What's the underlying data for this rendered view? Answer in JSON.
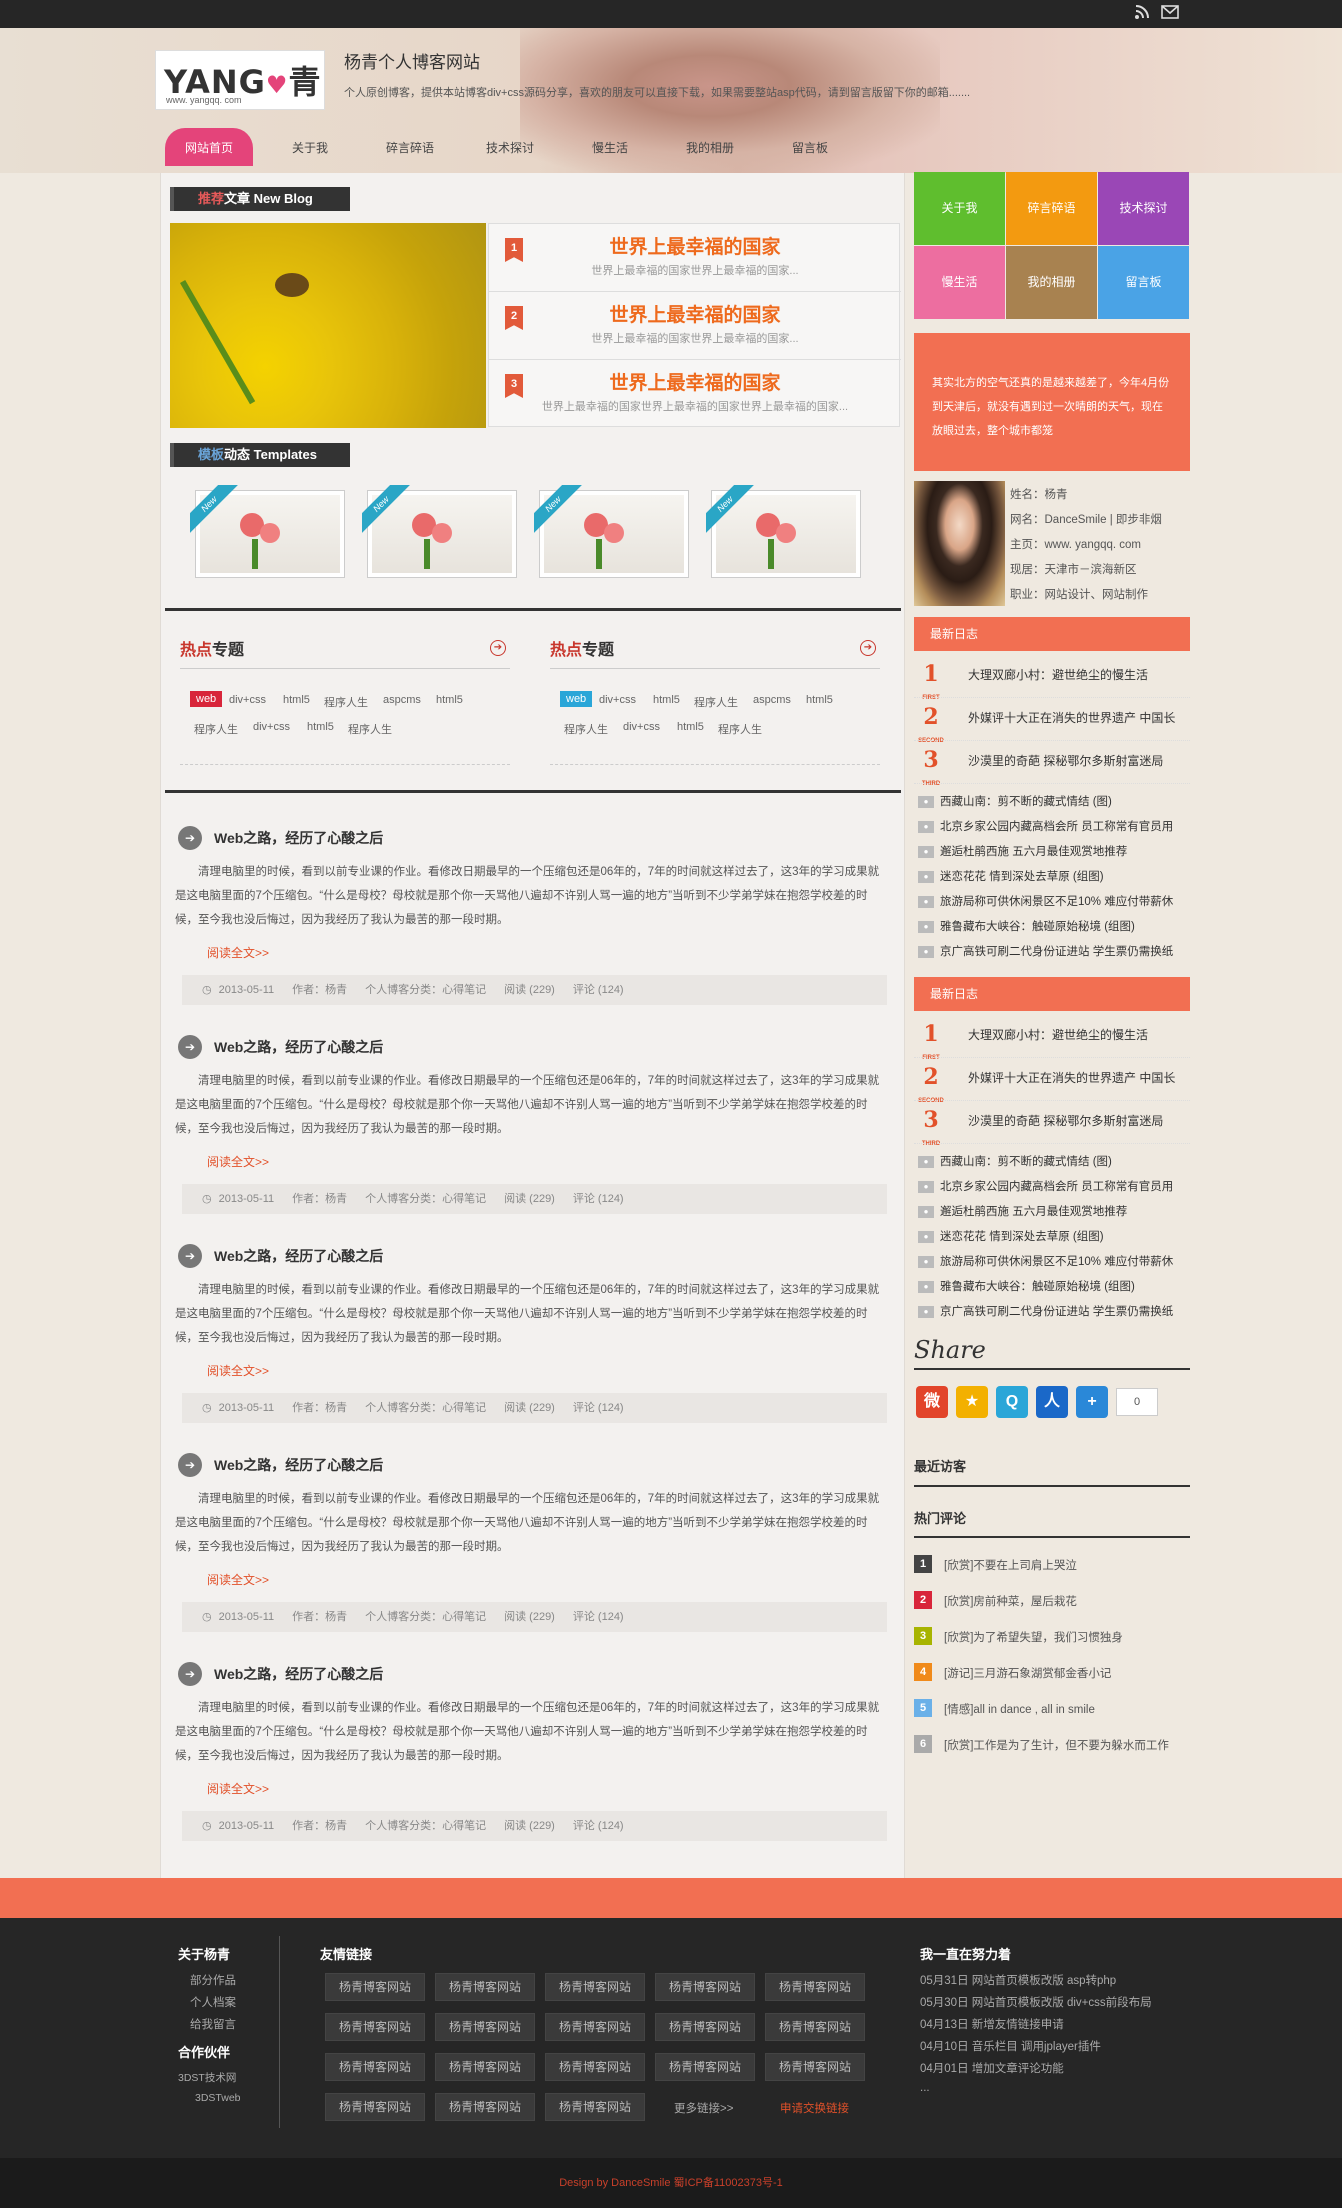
{
  "topbar": {
    "rss_icon": "rss-icon",
    "mail_icon": "mail-icon"
  },
  "header": {
    "logo_main": "YANG",
    "logo_heart": "♥",
    "logo_char": "青",
    "logo_url": "www. yangqq. com",
    "title": "杨青个人博客网站",
    "desc": "个人原创博客，提供本站博客div+css源码分享，喜欢的朋友可以直接下载，如果需要整站asp代码，请到留言版留下你的邮箱......."
  },
  "nav": [
    "网站首页",
    "关于我",
    "碎言碎语",
    "技术探讨",
    "慢生活",
    "我的相册",
    "留言板"
  ],
  "recommend": {
    "label_hl": "推荐",
    "label": "文章 New Blog",
    "items": [
      {
        "num": "1",
        "title": "世界上最幸福的国家",
        "sub": "世界上最幸福的国家世界上最幸福的国家..."
      },
      {
        "num": "2",
        "title": "世界上最幸福的国家",
        "sub": "世界上最幸福的国家世界上最幸福的国家..."
      },
      {
        "num": "3",
        "title": "世界上最幸福的国家",
        "sub": "世界上最幸福的国家世界上最幸福的国家世界上最幸福的国家..."
      }
    ]
  },
  "templates": {
    "label_hl": "模板",
    "label": "动态 Templates",
    "ribbon": "New"
  },
  "topics": [
    {
      "hl": "热点",
      "title": "专题",
      "tags_row1": [
        "web",
        "div+css",
        "html5",
        "程序人生",
        "aspcms",
        "html5"
      ],
      "tags_row2": [
        "程序人生",
        "div+css",
        "html5",
        "程序人生"
      ],
      "first_color": "#d8253a"
    },
    {
      "hl": "热点",
      "title": "专题",
      "tags_row1": [
        "web",
        "div+css",
        "html5",
        "程序人生",
        "aspcms",
        "html5"
      ],
      "tags_row2": [
        "程序人生",
        "div+css",
        "html5",
        "程序人生"
      ],
      "first_color": "#2aa6d8"
    }
  ],
  "posts": [
    {
      "title": "Web之路，经历了心酸之后",
      "body": "清理电脑里的时候，看到以前专业课的作业。看修改日期最早的一个压缩包还是06年的，7年的时间就这样过去了，这3年的学习成果就是这电脑里面的7个压缩包。“什么是母校？母校就是那个你一天骂他八遍却不许别人骂一遍的地方”当听到不少学弟学妹在抱怨学校差的时候，至今我也没后悔过，因为我经历了我认为最苦的那一段时期。",
      "more": "阅读全文>>",
      "date": "2013-05-11",
      "author": "作者：杨青",
      "category": "个人博客分类：心得笔记",
      "reads": "阅读 (229)",
      "comments": "评论 (124)"
    },
    {
      "title": "Web之路，经历了心酸之后",
      "body": "清理电脑里的时候，看到以前专业课的作业。看修改日期最早的一个压缩包还是06年的，7年的时间就这样过去了，这3年的学习成果就是这电脑里面的7个压缩包。“什么是母校？母校就是那个你一天骂他八遍却不许别人骂一遍的地方”当听到不少学弟学妹在抱怨学校差的时候，至今我也没后悔过，因为我经历了我认为最苦的那一段时期。",
      "more": "阅读全文>>",
      "date": "2013-05-11",
      "author": "作者：杨青",
      "category": "个人博客分类：心得笔记",
      "reads": "阅读 (229)",
      "comments": "评论 (124)"
    },
    {
      "title": "Web之路，经历了心酸之后",
      "body": "清理电脑里的时候，看到以前专业课的作业。看修改日期最早的一个压缩包还是06年的，7年的时间就这样过去了，这3年的学习成果就是这电脑里面的7个压缩包。“什么是母校？母校就是那个你一天骂他八遍却不许别人骂一遍的地方”当听到不少学弟学妹在抱怨学校差的时候，至今我也没后悔过，因为我经历了我认为最苦的那一段时期。",
      "more": "阅读全文>>",
      "date": "2013-05-11",
      "author": "作者：杨青",
      "category": "个人博客分类：心得笔记",
      "reads": "阅读 (229)",
      "comments": "评论 (124)"
    },
    {
      "title": "Web之路，经历了心酸之后",
      "body": "清理电脑里的时候，看到以前专业课的作业。看修改日期最早的一个压缩包还是06年的，7年的时间就这样过去了，这3年的学习成果就是这电脑里面的7个压缩包。“什么是母校？母校就是那个你一天骂他八遍却不许别人骂一遍的地方”当听到不少学弟学妹在抱怨学校差的时候，至今我也没后悔过，因为我经历了我认为最苦的那一段时期。",
      "more": "阅读全文>>",
      "date": "2013-05-11",
      "author": "作者：杨青",
      "category": "个人博客分类：心得笔记",
      "reads": "阅读 (229)",
      "comments": "评论 (124)"
    },
    {
      "title": "Web之路，经历了心酸之后",
      "body": "清理电脑里的时候，看到以前专业课的作业。看修改日期最早的一个压缩包还是06年的，7年的时间就这样过去了，这3年的学习成果就是这电脑里面的7个压缩包。“什么是母校？母校就是那个你一天骂他八遍却不许别人骂一遍的地方”当听到不少学弟学妹在抱怨学校差的时候，至今我也没后悔过，因为我经历了我认为最苦的那一段时期。",
      "more": "阅读全文>>",
      "date": "2013-05-11",
      "author": "作者：杨青",
      "category": "个人博客分类：心得笔记",
      "reads": "阅读 (229)",
      "comments": "评论 (124)"
    }
  ],
  "tiles": [
    {
      "label": "关于我",
      "color": "#5fbe2e"
    },
    {
      "label": "碎言碎语",
      "color": "#f39a10"
    },
    {
      "label": "技术探讨",
      "color": "#9a47b6"
    },
    {
      "label": "慢生活",
      "color": "#ed6ea0"
    },
    {
      "label": "我的相册",
      "color": "#a88250"
    },
    {
      "label": "留言板",
      "color": "#4aa3e6"
    }
  ],
  "quote": "其实北方的空气还真的是越来越差了，今年4月份到天津后，就没有遇到过一次晴朗的天气，现在放眼过去，整个城市都笼",
  "profile": {
    "name": "姓名：杨青",
    "nick": "网名：DanceSmile | 即步非烟",
    "home": "主页：www. yangqq. com",
    "location": "现居：天津市－滨海新区",
    "job": "职业：网站设计、网站制作"
  },
  "latest1": {
    "title": "最新日志",
    "top": [
      {
        "rank": "1",
        "badge": "FIRST",
        "text": "大理双廊小村：避世绝尘的慢生活"
      },
      {
        "rank": "2",
        "badge": "SECOND",
        "text": "外媒评十大正在消失的世界遗产 中国长"
      },
      {
        "rank": "3",
        "badge": "THIRD",
        "text": "沙漠里的奇葩 探秘鄂尔多斯射富迷局"
      }
    ],
    "list": [
      "西藏山南：剪不断的藏式情结 (图)",
      "北京乡家公园内藏高档会所 员工称常有官员用",
      "邂逅杜鹃西施 五六月最佳观赏地推荐",
      "迷恋花花 情到深处去草原 (组图)",
      "旅游局称可供休闲景区不足10% 难应付带薪休",
      "雅鲁藏布大峡谷：触碰原始秘境 (组图)",
      "京广高铁可刷二代身份证进站 学生票仍需换纸"
    ]
  },
  "latest2": {
    "title": "最新日志",
    "top": [
      {
        "rank": "1",
        "badge": "FIRST",
        "text": "大理双廊小村：避世绝尘的慢生活"
      },
      {
        "rank": "2",
        "badge": "SECOND",
        "text": "外媒评十大正在消失的世界遗产 中国长"
      },
      {
        "rank": "3",
        "badge": "THIRD",
        "text": "沙漠里的奇葩 探秘鄂尔多斯射富迷局"
      }
    ],
    "list": [
      "西藏山南：剪不断的藏式情结 (图)",
      "北京乡家公园内藏高档会所 员工称常有官员用",
      "邂逅杜鹃西施 五六月最佳观赏地推荐",
      "迷恋花花 情到深处去草原 (组图)",
      "旅游局称可供休闲景区不足10% 难应付带薪休",
      "雅鲁藏布大峡谷：触碰原始秘境 (组图)",
      "京广高铁可刷二代身份证进站 学生票仍需换纸"
    ]
  },
  "share": {
    "title": "Share",
    "count": "0",
    "icons": [
      {
        "name": "weibo-icon",
        "glyph": "微",
        "color": "#e2442a"
      },
      {
        "name": "qzone-icon",
        "glyph": "★",
        "color": "#f3b000"
      },
      {
        "name": "tqq-icon",
        "glyph": "Q",
        "color": "#2aa6d8"
      },
      {
        "name": "renren-icon",
        "glyph": "人",
        "color": "#1a68c8"
      },
      {
        "name": "more-icon",
        "glyph": "+",
        "color": "#2a88d8"
      }
    ]
  },
  "recent_visitors": "最近访客",
  "hot_comments": {
    "title": "热门评论",
    "items": [
      {
        "num": "1",
        "color": "#444",
        "text": "[欣赏]不要在上司肩上哭泣"
      },
      {
        "num": "2",
        "color": "#d8253a",
        "text": "[欣赏]房前种菜，屋后栽花"
      },
      {
        "num": "3",
        "color": "#a8b400",
        "text": "[欣赏]为了希望失望，我们习惯独身"
      },
      {
        "num": "4",
        "color": "#f08a1a",
        "text": "[游记]三月游石象湖赏郁金香小记"
      },
      {
        "num": "5",
        "color": "#6ab0e8",
        "text": "[情感]all in dance , all in smile"
      },
      {
        "num": "6",
        "color": "#aaa",
        "text": "[欣赏]工作是为了生计，但不要为躲水而工作"
      }
    ]
  },
  "footer": {
    "about_title": "关于杨青",
    "about_links": [
      "部分作品",
      "个人档案",
      "给我留言"
    ],
    "partner_title": "合作伙伴",
    "partner_links": [
      "3DST技术网",
      "3DSTweb"
    ],
    "friends_title": "友情链接",
    "friend_link": "杨青博客网站",
    "more_links": "更多链接>>",
    "apply_link": "申请交换链接",
    "log_title": "我一直在努力着",
    "log": [
      "05月31日 网站首页模板改版 asp转php",
      "05月30日 网站首页模板改版 div+css前段布局",
      "04月13日 新增友情链接申请",
      "04月10日 音乐栏目 调用jplayer插件",
      "04月01日 增加文章评论功能"
    ],
    "ellipsis": "...",
    "copyright": "Design by DanceSmile 蜀ICP备11002373号-1"
  }
}
